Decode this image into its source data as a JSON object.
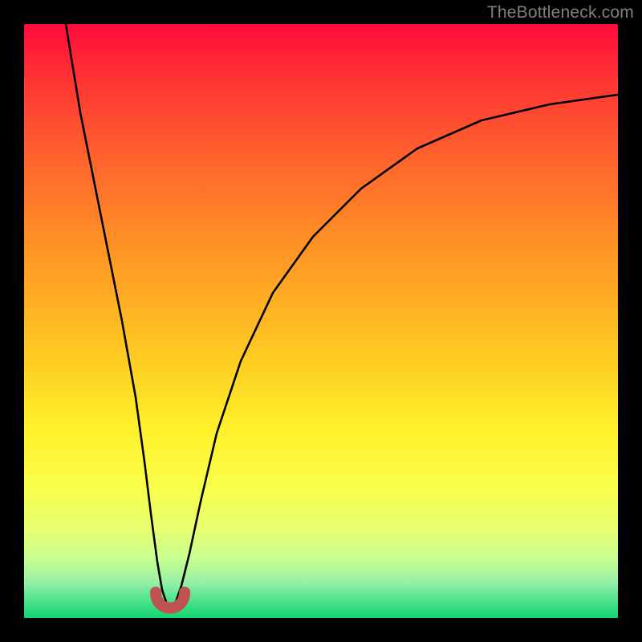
{
  "watermark": "TheBottleneck.com",
  "chart_data": {
    "type": "line",
    "title": "",
    "xlabel": "",
    "ylabel": "",
    "xlim": [
      0,
      100
    ],
    "ylim": [
      0,
      100
    ],
    "background": "red-yellow-green vertical gradient (red=top, green=bottom)",
    "note": "No numeric axis ticks are rendered; x is a relative position (0–100) and y is relative height (0 = bottom/green, 100 = top/red). Values estimated from pixels.",
    "series": [
      {
        "name": "left-branch",
        "x": [
          7,
          10,
          12,
          14,
          16,
          18,
          19.5,
          21,
          22
        ],
        "y": [
          100,
          80,
          67,
          54,
          42,
          29,
          18,
          9,
          3
        ]
      },
      {
        "name": "dip",
        "x": [
          22,
          23,
          24,
          25,
          26
        ],
        "y": [
          3,
          1.2,
          1.0,
          1.2,
          3
        ]
      },
      {
        "name": "right-branch",
        "x": [
          26,
          28,
          30,
          34,
          40,
          48,
          58,
          70,
          84,
          100
        ],
        "y": [
          3,
          12,
          22,
          37,
          52,
          64,
          73,
          80,
          85,
          88
        ]
      }
    ],
    "marker": {
      "name": "dip-marker",
      "shape": "U",
      "color": "#c0524f",
      "x_center": 24,
      "y_center": 2,
      "width": 5
    }
  }
}
